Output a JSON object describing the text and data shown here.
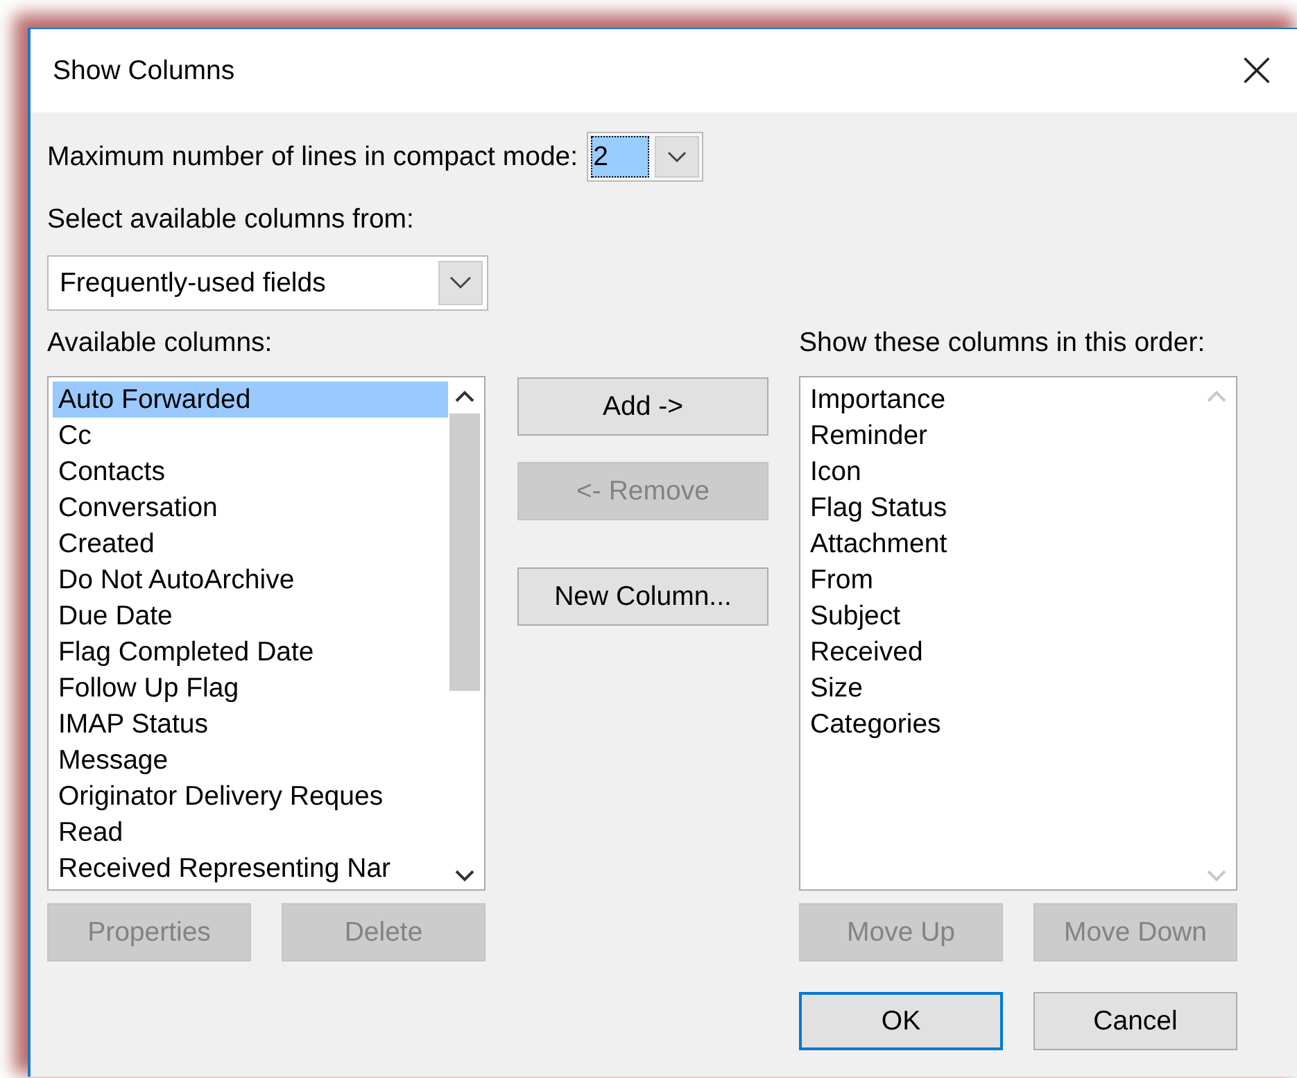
{
  "window": {
    "title": "Show Columns",
    "close": "×"
  },
  "compact_lines": {
    "label": "Maximum number of lines in compact mode:",
    "value": "2",
    "selected": true
  },
  "source": {
    "label": "Select available columns from:",
    "value": "Frequently-used fields"
  },
  "available": {
    "label": "Available columns:",
    "items": [
      {
        "text": "Auto Forwarded",
        "selected": true
      },
      {
        "text": "Cc",
        "selected": false
      },
      {
        "text": "Contacts",
        "selected": false
      },
      {
        "text": "Conversation",
        "selected": false
      },
      {
        "text": "Created",
        "selected": false
      },
      {
        "text": "Do Not AutoArchive",
        "selected": false
      },
      {
        "text": "Due Date",
        "selected": false
      },
      {
        "text": "Flag Completed Date",
        "selected": false
      },
      {
        "text": "Follow Up Flag",
        "selected": false
      },
      {
        "text": "IMAP Status",
        "selected": false
      },
      {
        "text": "Message",
        "selected": false
      },
      {
        "text": "Originator Delivery Reques",
        "selected": false
      },
      {
        "text": "Read",
        "selected": false
      },
      {
        "text": "Received Representing Nar",
        "selected": false
      }
    ]
  },
  "middle_buttons": [
    {
      "label": "Add ->",
      "disabled": false
    },
    {
      "label": "<- Remove",
      "disabled": true
    },
    {
      "label": "New Column...",
      "disabled": false
    }
  ],
  "shown": {
    "label": "Show these columns in this order:",
    "items": [
      {
        "text": "Importance",
        "selected": false
      },
      {
        "text": "Reminder",
        "selected": false
      },
      {
        "text": "Icon",
        "selected": false
      },
      {
        "text": "Flag Status",
        "selected": false
      },
      {
        "text": "Attachment",
        "selected": false
      },
      {
        "text": "From",
        "selected": false
      },
      {
        "text": "Subject",
        "selected": false
      },
      {
        "text": "Received",
        "selected": false
      },
      {
        "text": "Size",
        "selected": false
      },
      {
        "text": "Categories",
        "selected": false
      }
    ]
  },
  "left_buttons": [
    {
      "label": "Properties",
      "disabled": true
    },
    {
      "label": "Delete",
      "disabled": true
    }
  ],
  "right_buttons": [
    {
      "label": "Move Up",
      "disabled": true
    },
    {
      "label": "Move Down",
      "disabled": true
    }
  ],
  "dialog_buttons": [
    {
      "label": "OK",
      "default": true
    },
    {
      "label": "Cancel",
      "default": false
    }
  ]
}
